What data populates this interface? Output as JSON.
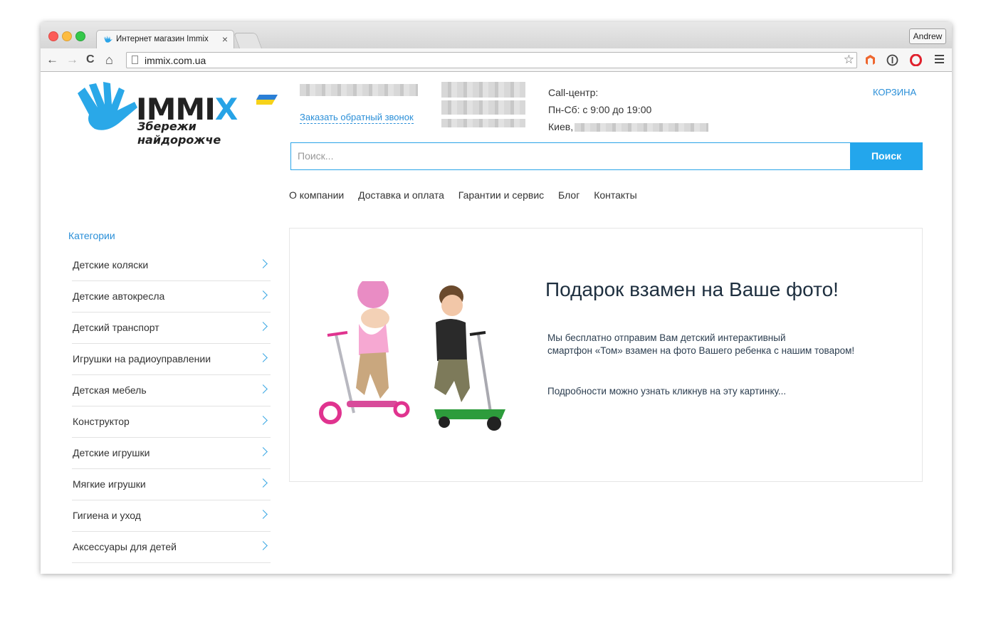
{
  "browser": {
    "tab_title": "Интернет магазин Immix",
    "tab_close": "×",
    "profile": "Andrew",
    "url": "immix.com.ua",
    "nav": {
      "back": "←",
      "forward": "→",
      "reload": "C",
      "home": "⌂",
      "star": "☆"
    }
  },
  "header": {
    "logo_text_main": "IMMIX",
    "logo_slogan": "Збережи найдорожче",
    "callback_link": "Заказать обратный звонок",
    "contacts": {
      "line1": "Call-центр:",
      "line2": "Пн-Сб: с 9:00 до 19:00",
      "line3": "Киев,"
    },
    "cart": "КОРЗИНА",
    "search_placeholder": "Поиск...",
    "search_button": "Поиск"
  },
  "top_nav": [
    "О компании",
    "Доставка и оплата",
    "Гарантии и сервис",
    "Блог",
    "Контакты"
  ],
  "sidebar": {
    "title": "Категории",
    "items": [
      "Детские коляски",
      "Детские автокресла",
      "Детский транспорт",
      "Игрушки на радиоуправлении",
      "Детская мебель",
      "Конструктор",
      "Детские игрушки",
      "Мягкие игрушки",
      "Гигиена и уход",
      "Аксессуары для детей"
    ]
  },
  "banner": {
    "title": "Подарок взамен на Ваше фото!",
    "text_line1": "Мы бесплатно отправим Вам детский интерактивный",
    "text_line2": "смартфон «Том» взамен на фото Вашего ребенка с нашим товаром!",
    "more": "Подробности можно узнать кликнув на эту картинку..."
  },
  "colors": {
    "accent": "#23a6ec",
    "link": "#2a8fd8",
    "title": "#1e2f3f"
  }
}
